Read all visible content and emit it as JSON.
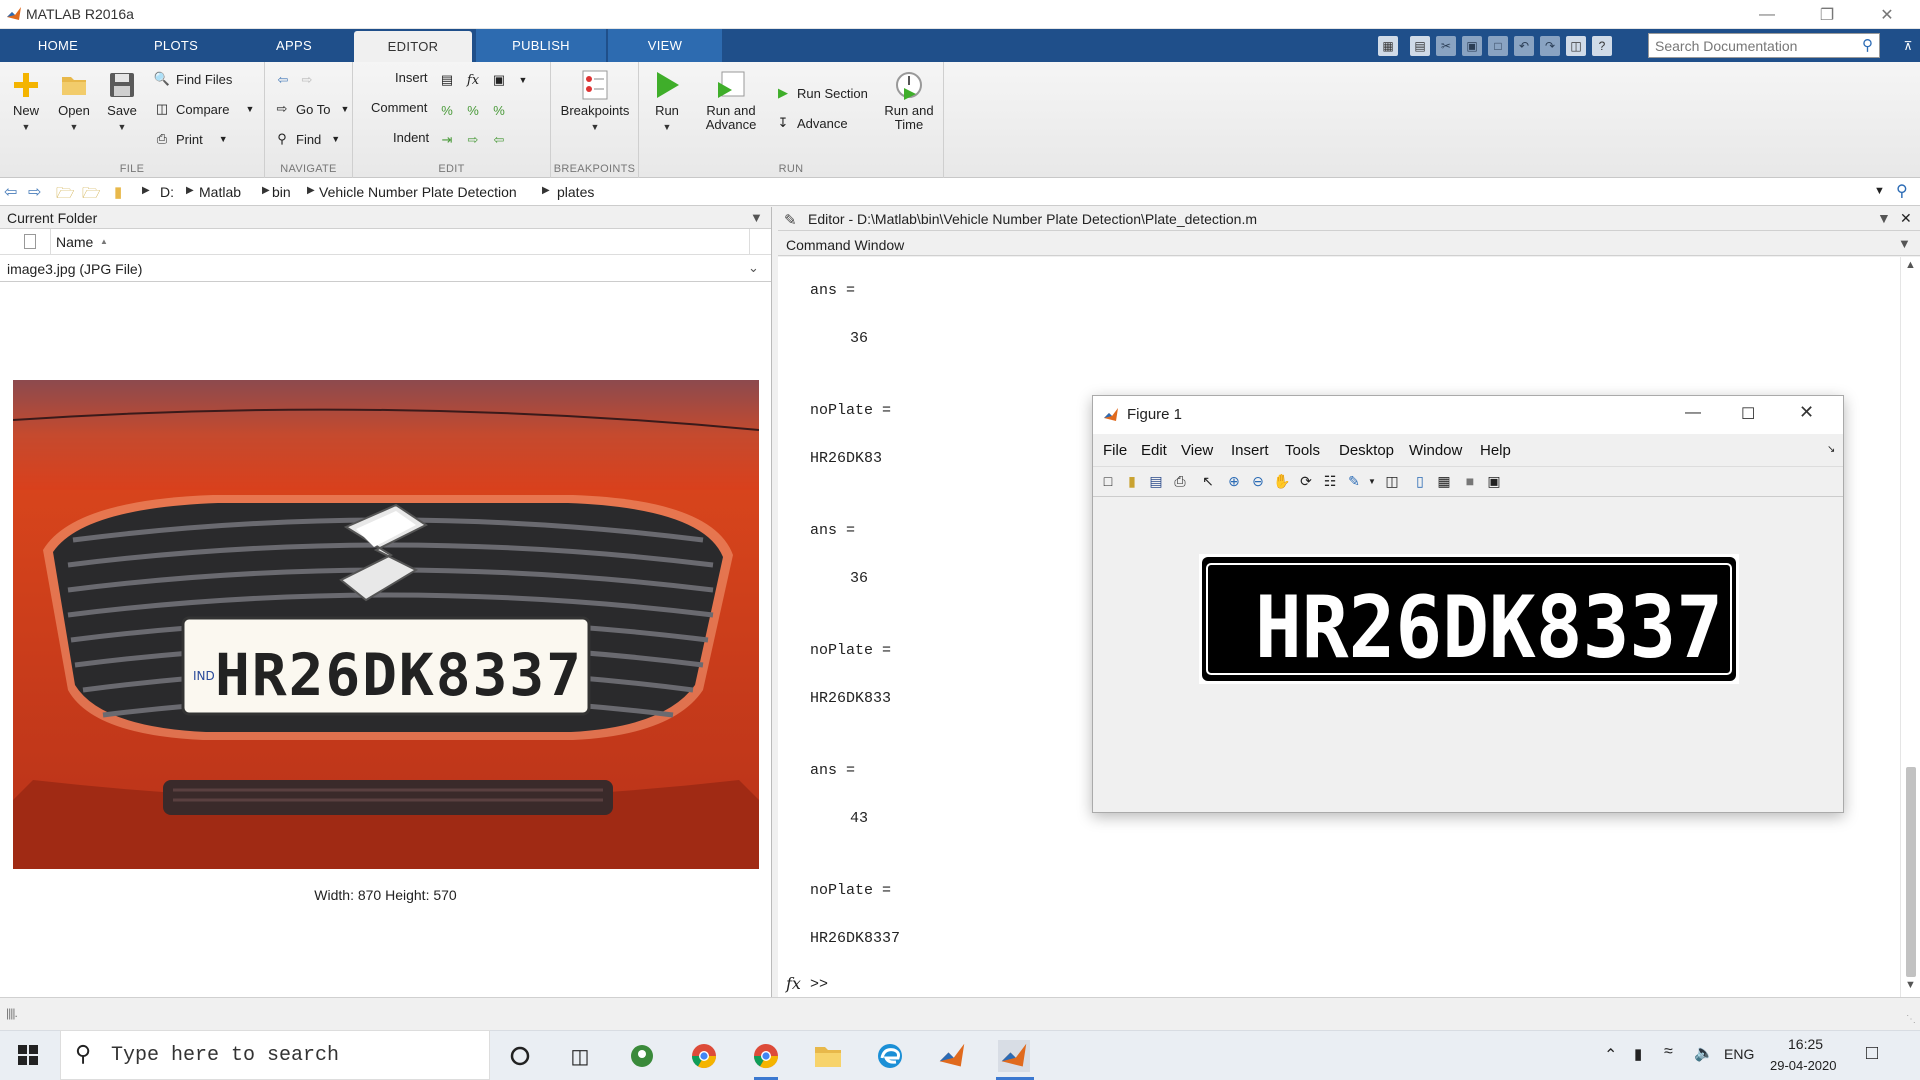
{
  "window": {
    "title": "MATLAB R2016a"
  },
  "tabs": [
    "HOME",
    "PLOTS",
    "APPS",
    "EDITOR",
    "PUBLISH",
    "VIEW"
  ],
  "active_tab": "EDITOR",
  "search": {
    "placeholder": "Search Documentation"
  },
  "ribbon": {
    "file": {
      "caption": "FILE",
      "new": "New",
      "open": "Open",
      "save": "Save",
      "find_files": "Find Files",
      "compare": "Compare",
      "print": "Print"
    },
    "navigate": {
      "caption": "NAVIGATE",
      "go_to": "Go To",
      "find": "Find"
    },
    "edit": {
      "caption": "EDIT",
      "insert": "Insert",
      "comment": "Comment",
      "indent": "Indent"
    },
    "breakpoints": {
      "caption": "BREAKPOINTS",
      "label": "Breakpoints"
    },
    "run": {
      "caption": "RUN",
      "run": "Run",
      "run_and_advance_1": "Run and",
      "run_and_advance_2": "Advance",
      "run_section": "Run Section",
      "advance": "Advance",
      "run_and_time_1": "Run and",
      "run_and_time_2": "Time"
    }
  },
  "address": {
    "crumbs": [
      "D:",
      "Matlab",
      "bin",
      "Vehicle Number Plate Detection",
      "plates"
    ]
  },
  "current_folder": {
    "title": "Current Folder",
    "column_name": "Name",
    "sort_indicator": "▲",
    "selected_file": "image3.jpg  (JPG File)",
    "preview_caption": "Width: 870 Height: 570",
    "plate_text": "HR26DK8337",
    "plate_prefix": "IND"
  },
  "editor": {
    "title": "Editor - D:\\Matlab\\bin\\Vehicle Number Plate Detection\\Plate_detection.m"
  },
  "command_window": {
    "title": "Command Window",
    "lines": [
      "ans =",
      "36",
      "noPlate =",
      "HR26DK83",
      "ans =",
      "36",
      "noPlate =",
      "HR26DK833",
      "ans =",
      "43",
      "noPlate =",
      "HR26DK8337"
    ],
    "prompt_symbol": "fx",
    "prompt": ">>"
  },
  "figure": {
    "title": "Figure 1",
    "menus": [
      "File",
      "Edit",
      "View",
      "Insert",
      "Tools",
      "Desktop",
      "Window",
      "Help"
    ],
    "plate_text": "HR26DK8337"
  },
  "taskbar": {
    "search_placeholder": "Type here to search",
    "language": "ENG",
    "time": "16:25",
    "date": "29-04-2020"
  }
}
